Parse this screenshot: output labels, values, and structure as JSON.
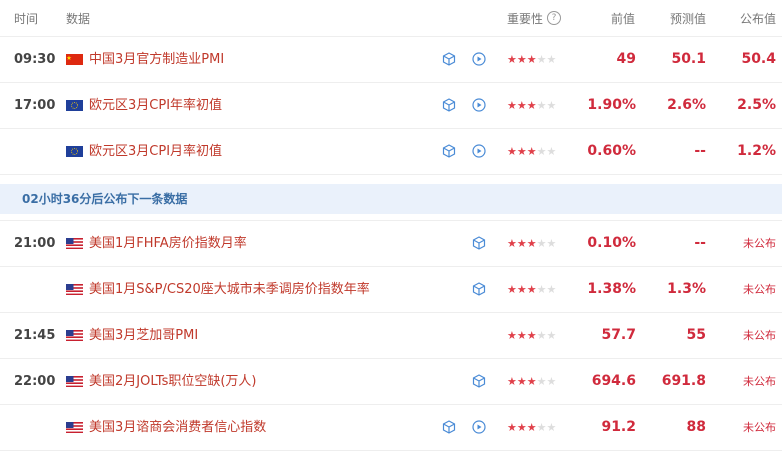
{
  "header": {
    "time": "时间",
    "data": "数据",
    "importance": "重要性",
    "help": "?",
    "previous": "前值",
    "forecast": "预测值",
    "actual": "公布值"
  },
  "banner": "02小时36分后公布下一条数据",
  "colors": {
    "accent": "#d02a3c",
    "banner_bg": "#eaf1fb",
    "banner_text": "#3a6ea5"
  },
  "rows": [
    {
      "time": "09:30",
      "flag": "cn-flag-icon",
      "name": "中国3月官方制造业PMI",
      "stars": 3,
      "previous": "49",
      "forecast": "50.1",
      "actual": "50.4"
    },
    {
      "time": "17:00",
      "flag": "eu-flag-icon",
      "name": "欧元区3月CPI年率初值",
      "stars": 3,
      "previous": "1.90%",
      "forecast": "2.6%",
      "actual": "2.5%"
    },
    {
      "time": "",
      "flag": "eu-flag-icon",
      "name": "欧元区3月CPI月率初值",
      "stars": 3,
      "previous": "0.60%",
      "forecast": "--",
      "actual": "1.2%"
    },
    {
      "time": "21:00",
      "flag": "us-flag-icon",
      "name": "美国1月FHFA房价指数月率",
      "stars": 3,
      "previous": "0.10%",
      "forecast": "--",
      "actual": "未公布"
    },
    {
      "time": "",
      "flag": "us-flag-icon",
      "name": "美国1月S&P/CS20座大城市未季调房价指数年率",
      "stars": 3,
      "previous": "1.38%",
      "forecast": "1.3%",
      "actual": "未公布"
    },
    {
      "time": "21:45",
      "flag": "us-flag-icon",
      "name": "美国3月芝加哥PMI",
      "stars": 3,
      "previous": "57.7",
      "forecast": "55",
      "actual": "未公布"
    },
    {
      "time": "22:00",
      "flag": "us-flag-icon",
      "name": "美国2月JOLTs职位空缺(万人)",
      "stars": 3,
      "previous": "694.6",
      "forecast": "691.8",
      "actual": "未公布"
    },
    {
      "time": "",
      "flag": "us-flag-icon",
      "name": "美国3月谘商会消费者信心指数",
      "stars": 3,
      "previous": "91.2",
      "forecast": "88",
      "actual": "未公布"
    }
  ]
}
